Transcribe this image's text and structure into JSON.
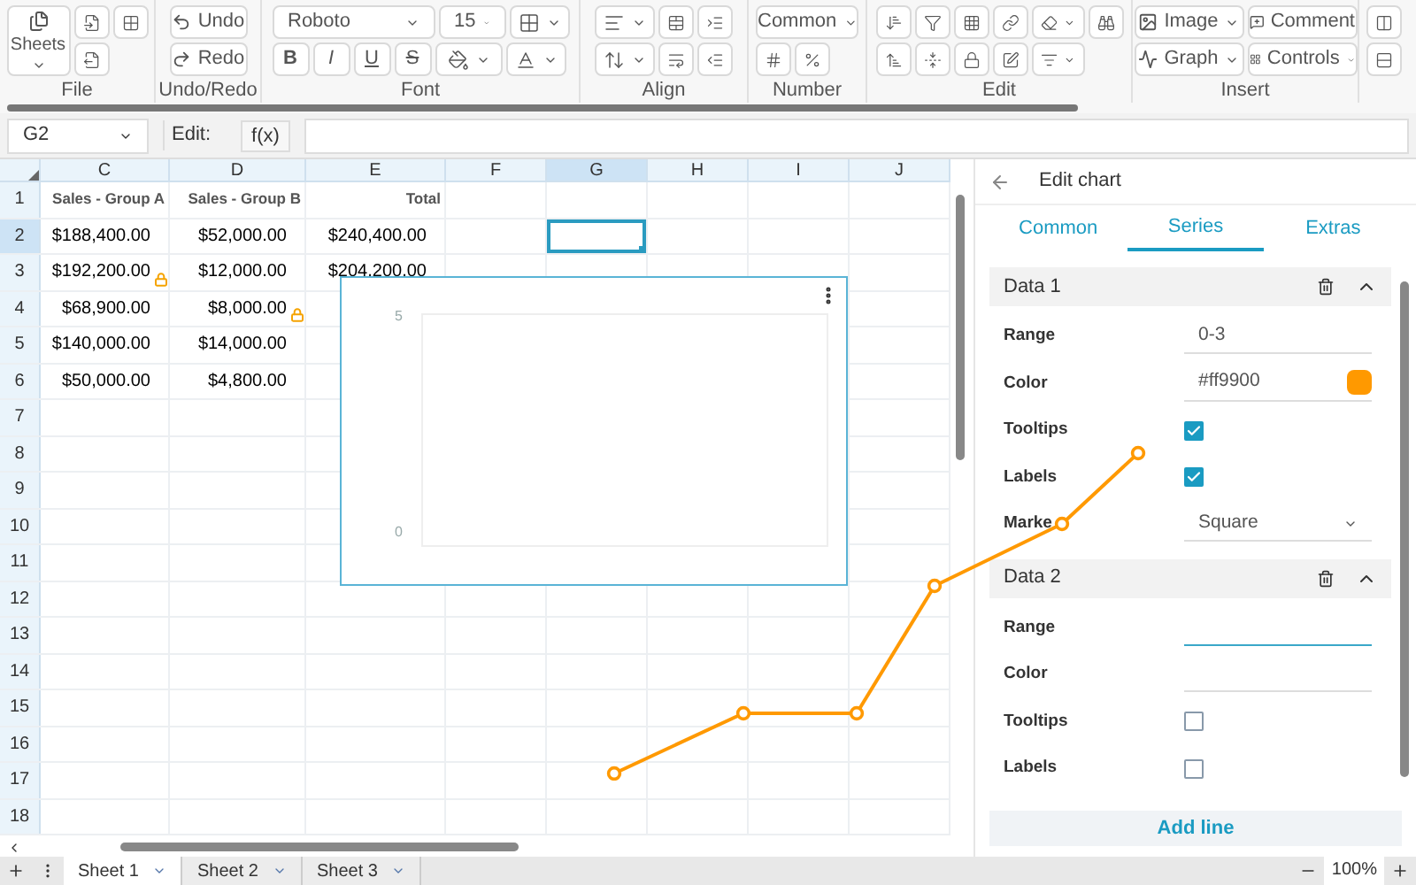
{
  "toolbar": {
    "file": {
      "sheets": "Sheets",
      "label": "File"
    },
    "undo_redo": {
      "undo": "Undo",
      "redo": "Redo",
      "label": "Undo/Redo"
    },
    "font": {
      "family": "Roboto",
      "size": "15",
      "bold": "B",
      "italic": "I",
      "underline": "U",
      "strike": "S",
      "label": "Font"
    },
    "align": {
      "label": "Align"
    },
    "number": {
      "format": "Common",
      "label": "Number"
    },
    "edit": {
      "label": "Edit"
    },
    "insert": {
      "image": "Image",
      "comment": "Comment",
      "graph": "Graph",
      "controls": "Controls",
      "label": "Insert"
    }
  },
  "formula_bar": {
    "cell": "G2",
    "edit_label": "Edit:",
    "fx": "f(x)"
  },
  "grid": {
    "columns": [
      {
        "label": "C",
        "selected": false
      },
      {
        "label": "D",
        "selected": false
      },
      {
        "label": "E",
        "selected": false
      },
      {
        "label": "F",
        "selected": false
      },
      {
        "label": "G",
        "selected": true
      },
      {
        "label": "H",
        "selected": false
      },
      {
        "label": "I",
        "selected": false
      },
      {
        "label": "J",
        "selected": false
      }
    ],
    "rows": [
      {
        "label": "1",
        "selected": false,
        "cells": [
          {
            "text": "Sales - Group A",
            "bold": true,
            "locked": false
          },
          {
            "text": "Sales - Group B",
            "bold": true,
            "locked": false
          },
          {
            "text": "Total",
            "bold": true,
            "locked": false
          }
        ]
      },
      {
        "label": "2",
        "selected": true,
        "cells": [
          {
            "text": "$188,400.00",
            "bold": false,
            "locked": false
          },
          {
            "text": "$52,000.00",
            "bold": false,
            "locked": false
          },
          {
            "text": "$240,400.00",
            "bold": false,
            "locked": false
          }
        ]
      },
      {
        "label": "3",
        "selected": false,
        "cells": [
          {
            "text": "$192,200.00",
            "bold": false,
            "locked": true
          },
          {
            "text": "$12,000.00",
            "bold": false,
            "locked": false
          },
          {
            "text": "$204,200.00",
            "bold": false,
            "locked": false
          }
        ]
      },
      {
        "label": "4",
        "selected": false,
        "cells": [
          {
            "text": "$68,900.00",
            "bold": false,
            "locked": false
          },
          {
            "text": "$8,000.00",
            "bold": false,
            "locked": true
          }
        ]
      },
      {
        "label": "5",
        "selected": false,
        "cells": [
          {
            "text": "$140,000.00",
            "bold": false,
            "locked": false
          },
          {
            "text": "$14,000.00",
            "bold": false,
            "locked": false
          }
        ]
      },
      {
        "label": "6",
        "selected": false,
        "cells": [
          {
            "text": "$50,000.00",
            "bold": false,
            "locked": false
          },
          {
            "text": "$4,800.00",
            "bold": false,
            "locked": false
          }
        ]
      },
      {
        "label": "7",
        "selected": false
      },
      {
        "label": "8",
        "selected": false
      },
      {
        "label": "9",
        "selected": false
      },
      {
        "label": "10",
        "selected": false
      },
      {
        "label": "11",
        "selected": false
      },
      {
        "label": "12",
        "selected": false
      },
      {
        "label": "13",
        "selected": false
      },
      {
        "label": "14",
        "selected": false
      },
      {
        "label": "15",
        "selected": false
      },
      {
        "label": "16",
        "selected": false
      },
      {
        "label": "17",
        "selected": false
      },
      {
        "label": "18",
        "selected": false
      }
    ]
  },
  "chart_overlay": {
    "ytick_labels": [
      "5",
      "0"
    ]
  },
  "panel": {
    "title": "Edit chart",
    "tabs": [
      {
        "label": "Common",
        "selected": false
      },
      {
        "label": "Series",
        "selected": true
      },
      {
        "label": "Extras",
        "selected": false
      }
    ],
    "series": [
      {
        "name": "Data 1",
        "expanded": true,
        "fields": [
          {
            "kind": "text",
            "label": "Range",
            "value": "0-3",
            "focused": false
          },
          {
            "kind": "color",
            "label": "Color",
            "value": "#ff9900",
            "color": "#ff9900"
          },
          {
            "kind": "checkbox",
            "label": "Tooltips",
            "checked": true
          },
          {
            "kind": "checkbox",
            "label": "Labels",
            "checked": true
          },
          {
            "kind": "select",
            "label": "Marke",
            "value": "Square"
          }
        ]
      },
      {
        "name": "Data 2",
        "expanded": true,
        "fields": [
          {
            "kind": "text",
            "label": "Range",
            "focused": true
          },
          {
            "kind": "color",
            "label": "Color"
          },
          {
            "kind": "checkbox",
            "label": "Tooltips",
            "checked": false
          },
          {
            "kind": "checkbox",
            "label": "Labels",
            "checked": false
          }
        ]
      }
    ],
    "add_button": "Add line"
  },
  "sheet_tabs": [
    {
      "label": "Sheet 1",
      "selected": true
    },
    {
      "label": "Sheet 2",
      "selected": false
    },
    {
      "label": "Sheet 3",
      "selected": false
    }
  ],
  "zoom": "100%"
}
